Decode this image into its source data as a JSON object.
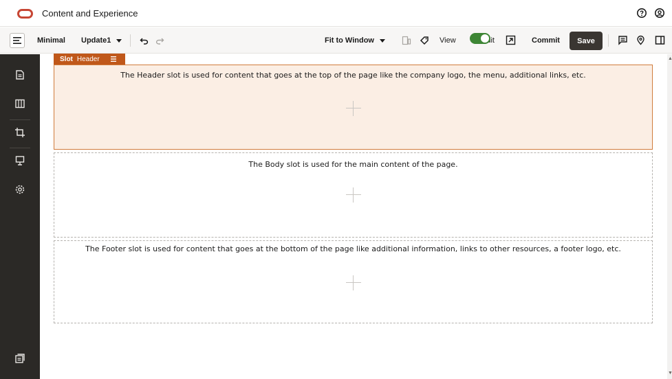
{
  "app": {
    "title": "Content and Experience",
    "icons": [
      "help-icon",
      "user-icon"
    ]
  },
  "toolbar": {
    "layout_label": "Minimal",
    "update_label": "Update1",
    "fit_label": "Fit to Window",
    "view_label": "View",
    "edit_label": "Edit",
    "edit_mode_on": true,
    "commit_label": "Commit",
    "save_label": "Save"
  },
  "rail": {
    "items": [
      "pages-icon",
      "layout-icon",
      "crop-icon",
      "components-icon",
      "settings-icon"
    ],
    "bottom_item": "preview-icon"
  },
  "slot_tag": {
    "prefix": "Slot",
    "name": "Header"
  },
  "slots": [
    {
      "name": "Header",
      "description": "The Header slot is used for content that goes at the top of the page like the company logo, the menu, additional links, etc."
    },
    {
      "name": "Body",
      "description": "The Body slot is used for the main content of the page."
    },
    {
      "name": "Footer",
      "description": "The Footer slot is used for content that goes at the bottom of the page like additional information, links to other resources, a footer logo, etc."
    }
  ],
  "colors": {
    "brand": "#c74634",
    "selected_slot_bg": "#fbeee4",
    "selected_slot_border": "#d07b3b",
    "slot_tag": "#c0581a",
    "toggle_on": "#3e8635",
    "rail_bg": "#2b2926",
    "save_bg": "#3a3632"
  }
}
